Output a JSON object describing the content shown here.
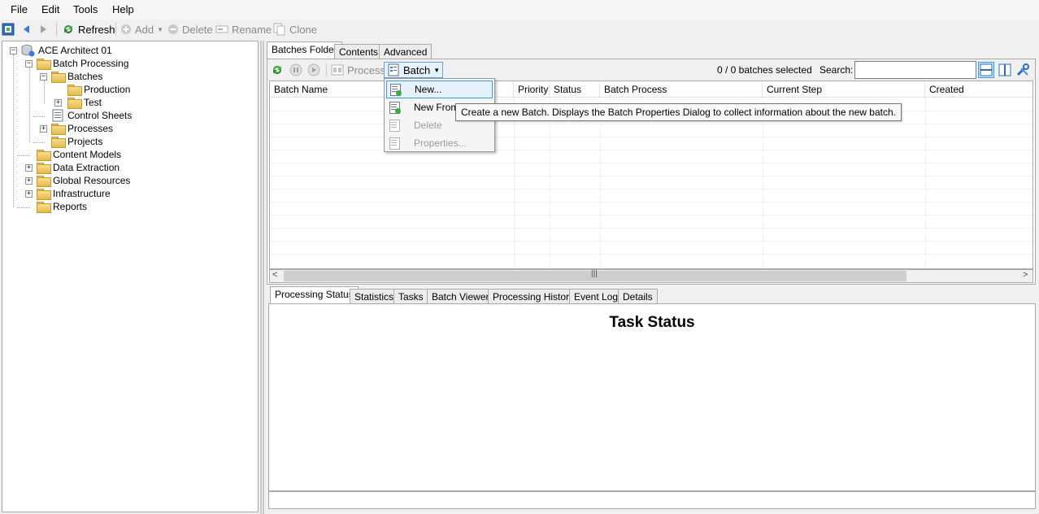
{
  "menubar": {
    "items": [
      "File",
      "Edit",
      "Tools",
      "Help"
    ]
  },
  "toolbar": {
    "refresh": "Refresh",
    "add": "Add",
    "delete": "Delete",
    "rename": "Rename",
    "clone": "Clone"
  },
  "tree": {
    "root": "ACE Architect 01",
    "batch_processing": "Batch Processing",
    "batches": "Batches",
    "production": "Production",
    "test": "Test",
    "control_sheets": "Control Sheets",
    "processes": "Processes",
    "projects": "Projects",
    "content_models": "Content Models",
    "data_extraction": "Data Extraction",
    "global_resources": "Global Resources",
    "infrastructure": "Infrastructure",
    "reports": "Reports"
  },
  "top_tabs": [
    "Batches Folder",
    "Contents",
    "Advanced"
  ],
  "batch_toolbar": {
    "process": "Process",
    "batch": "Batch",
    "selected_count": "0 / 0 batches selected",
    "search_label": "Search:",
    "search_value": ""
  },
  "grid": {
    "columns": [
      "Batch Name",
      "Priority",
      "Status",
      "Batch Process",
      "Current Step",
      "Created"
    ]
  },
  "batch_menu": {
    "items": [
      {
        "label": "New...",
        "enabled": true
      },
      {
        "label": "New From",
        "enabled": true
      },
      {
        "label": "Delete",
        "enabled": false
      },
      {
        "label": "Properties...",
        "enabled": false
      }
    ]
  },
  "tooltip": "Create a new Batch. Displays the Batch Properties Dialog to collect information about the new batch.",
  "bottom_tabs": [
    "Processing Status",
    "Statistics",
    "Tasks",
    "Batch Viewer",
    "Processing History",
    "Event Log",
    "Details"
  ],
  "bottom_panel": {
    "heading": "Task Status"
  },
  "colors": {
    "accent": "#3399ff",
    "highlight_bg": "#e5f1fb",
    "refresh_green": "#3fa83f"
  }
}
